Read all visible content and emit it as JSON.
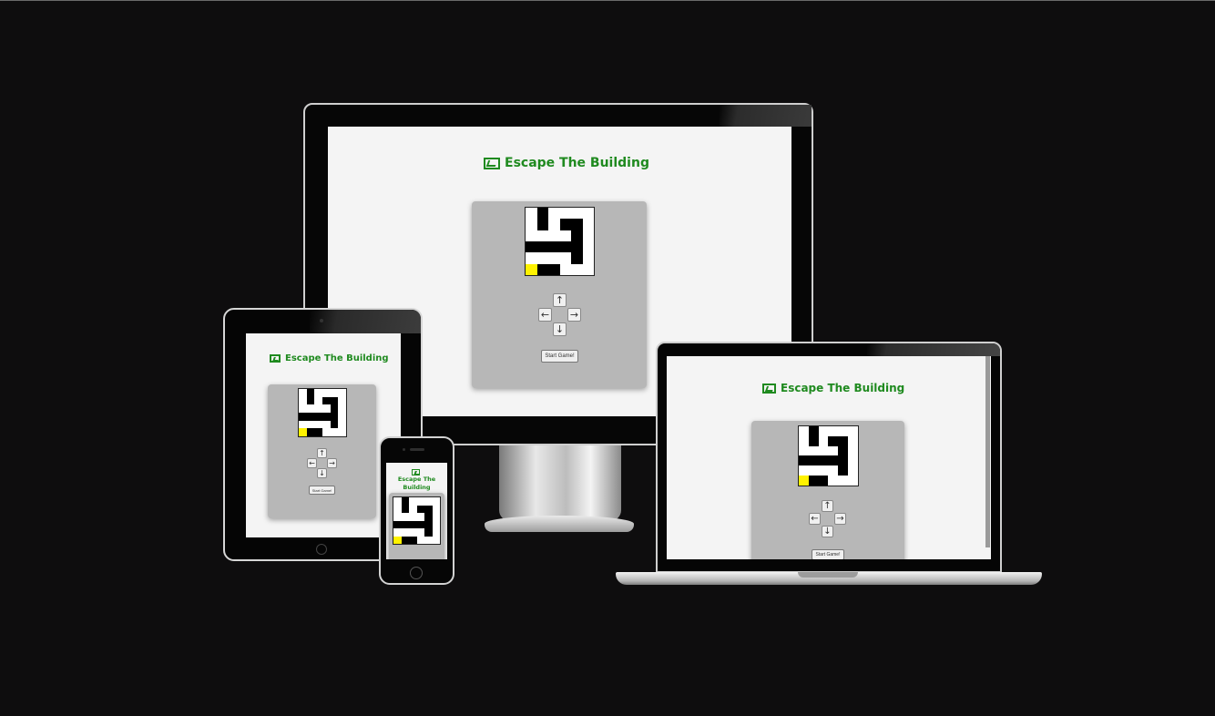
{
  "app": {
    "title": "Escape The Building",
    "start_label": "Start Game!",
    "arrow_up": "↑",
    "arrow_left": "←",
    "arrow_right": "→",
    "arrow_down": "↓"
  },
  "maze": {
    "cols": 6,
    "rows": 6,
    "player_color": "#fff200",
    "cells": [
      "oWoooo",
      "oWoWWo",
      "ooooWo",
      "WWWWWo",
      "ooooWo",
      "PWWooo"
    ]
  },
  "colors": {
    "background": "#0e0d0e",
    "title_green": "#1f8a1f",
    "panel_gray": "#b7b7b7",
    "page_bg": "#f4f4f4"
  }
}
